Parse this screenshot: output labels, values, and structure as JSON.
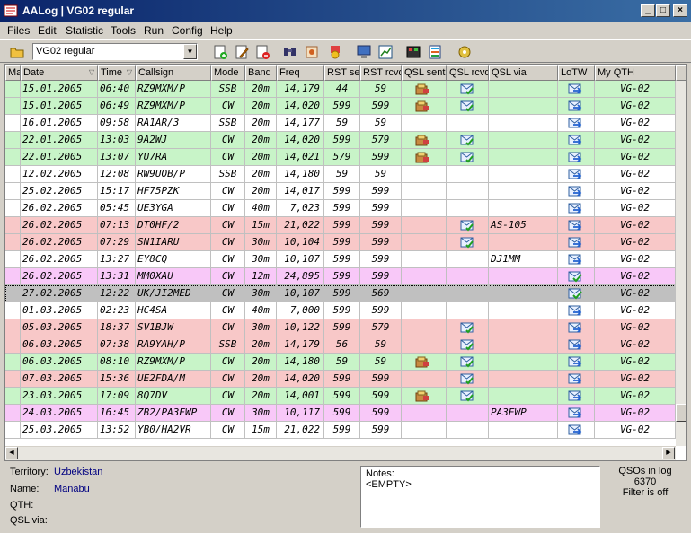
{
  "window": {
    "title": "AALog | VG02 regular"
  },
  "menu": [
    "Files",
    "Edit",
    "Statistic",
    "Tools",
    "Run",
    "Config",
    "Help"
  ],
  "toolbar": {
    "log_selector": "VG02 regular"
  },
  "columns": [
    "Ma",
    "Date",
    "Time",
    "Callsign",
    "Mode",
    "Band",
    "Freq",
    "RST sen",
    "RST rcvd",
    "QSL sent",
    "QSL rcvd",
    "QSL via",
    "LoTW",
    "My QTH"
  ],
  "rows": [
    {
      "c": "green",
      "date": "15.01.2005",
      "time": "06:40",
      "call": "RZ9MXM/P",
      "mode": "SSB",
      "band": "20m",
      "freq": "14,179",
      "rsts": "44",
      "rstr": "59",
      "qs": true,
      "qr": true,
      "via": "",
      "lotw": "send",
      "qth": "VG-02"
    },
    {
      "c": "green",
      "date": "15.01.2005",
      "time": "06:49",
      "call": "RZ9MXM/P",
      "mode": "CW",
      "band": "20m",
      "freq": "14,020",
      "rsts": "599",
      "rstr": "599",
      "qs": true,
      "qr": true,
      "via": "",
      "lotw": "send",
      "qth": "VG-02"
    },
    {
      "c": "white",
      "date": "16.01.2005",
      "time": "09:58",
      "call": "RA1AR/3",
      "mode": "SSB",
      "band": "20m",
      "freq": "14,177",
      "rsts": "59",
      "rstr": "59",
      "qs": false,
      "qr": false,
      "via": "",
      "lotw": "send",
      "qth": "VG-02"
    },
    {
      "c": "green",
      "date": "22.01.2005",
      "time": "13:03",
      "call": "9A2WJ",
      "mode": "CW",
      "band": "20m",
      "freq": "14,020",
      "rsts": "599",
      "rstr": "579",
      "qs": true,
      "qr": true,
      "via": "",
      "lotw": "send",
      "qth": "VG-02"
    },
    {
      "c": "green",
      "date": "22.01.2005",
      "time": "13:07",
      "call": "YU7RA",
      "mode": "CW",
      "band": "20m",
      "freq": "14,021",
      "rsts": "579",
      "rstr": "599",
      "qs": true,
      "qr": true,
      "via": "",
      "lotw": "send",
      "qth": "VG-02"
    },
    {
      "c": "white",
      "date": "12.02.2005",
      "time": "12:08",
      "call": "RW9UOB/P",
      "mode": "SSB",
      "band": "20m",
      "freq": "14,180",
      "rsts": "59",
      "rstr": "59",
      "qs": false,
      "qr": false,
      "via": "",
      "lotw": "send",
      "qth": "VG-02"
    },
    {
      "c": "white",
      "date": "25.02.2005",
      "time": "15:17",
      "call": "HF75PZK",
      "mode": "CW",
      "band": "20m",
      "freq": "14,017",
      "rsts": "599",
      "rstr": "599",
      "qs": false,
      "qr": false,
      "via": "",
      "lotw": "send",
      "qth": "VG-02"
    },
    {
      "c": "white",
      "date": "26.02.2005",
      "time": "05:45",
      "call": "UE3YGA",
      "mode": "CW",
      "band": "40m",
      "freq": "7,023",
      "rsts": "599",
      "rstr": "599",
      "qs": false,
      "qr": false,
      "via": "",
      "lotw": "send",
      "qth": "VG-02"
    },
    {
      "c": "red",
      "date": "26.02.2005",
      "time": "07:13",
      "call": "DT0HF/2",
      "mode": "CW",
      "band": "15m",
      "freq": "21,022",
      "rsts": "599",
      "rstr": "599",
      "qs": false,
      "qr": true,
      "via": "AS-105",
      "lotw": "send",
      "qth": "VG-02"
    },
    {
      "c": "red",
      "date": "26.02.2005",
      "time": "07:29",
      "call": "SN1IARU",
      "mode": "CW",
      "band": "30m",
      "freq": "10,104",
      "rsts": "599",
      "rstr": "599",
      "qs": false,
      "qr": true,
      "via": "",
      "lotw": "send",
      "qth": "VG-02"
    },
    {
      "c": "white",
      "date": "26.02.2005",
      "time": "13:27",
      "call": "EY8CQ",
      "mode": "CW",
      "band": "30m",
      "freq": "10,107",
      "rsts": "599",
      "rstr": "599",
      "qs": false,
      "qr": false,
      "via": "DJ1MM",
      "lotw": "send",
      "qth": "VG-02"
    },
    {
      "c": "pink",
      "date": "26.02.2005",
      "time": "13:31",
      "call": "MM0XAU",
      "mode": "CW",
      "band": "12m",
      "freq": "24,895",
      "rsts": "599",
      "rstr": "599",
      "qs": false,
      "qr": false,
      "via": "",
      "lotw": "conf",
      "qth": "VG-02"
    },
    {
      "c": "sel",
      "date": "27.02.2005",
      "time": "12:22",
      "call": "UK/JI2MED",
      "mode": "CW",
      "band": "30m",
      "freq": "10,107",
      "rsts": "599",
      "rstr": "569",
      "qs": false,
      "qr": false,
      "via": "",
      "lotw": "conf",
      "qth": "VG-02"
    },
    {
      "c": "white",
      "date": "01.03.2005",
      "time": "02:23",
      "call": "HC4SA",
      "mode": "CW",
      "band": "40m",
      "freq": "7,000",
      "rsts": "599",
      "rstr": "599",
      "qs": false,
      "qr": false,
      "via": "",
      "lotw": "send",
      "qth": "VG-02"
    },
    {
      "c": "red",
      "date": "05.03.2005",
      "time": "18:37",
      "call": "SV1BJW",
      "mode": "CW",
      "band": "30m",
      "freq": "10,122",
      "rsts": "599",
      "rstr": "579",
      "qs": false,
      "qr": true,
      "via": "",
      "lotw": "send",
      "qth": "VG-02"
    },
    {
      "c": "red",
      "date": "06.03.2005",
      "time": "07:38",
      "call": "RA9YAH/P",
      "mode": "SSB",
      "band": "20m",
      "freq": "14,179",
      "rsts": "56",
      "rstr": "59",
      "qs": false,
      "qr": true,
      "via": "",
      "lotw": "send",
      "qth": "VG-02"
    },
    {
      "c": "green",
      "date": "06.03.2005",
      "time": "08:10",
      "call": "RZ9MXM/P",
      "mode": "CW",
      "band": "20m",
      "freq": "14,180",
      "rsts": "59",
      "rstr": "59",
      "qs": true,
      "qr": true,
      "via": "",
      "lotw": "send",
      "qth": "VG-02"
    },
    {
      "c": "red",
      "date": "07.03.2005",
      "time": "15:36",
      "call": "UE2FDA/M",
      "mode": "CW",
      "band": "20m",
      "freq": "14,020",
      "rsts": "599",
      "rstr": "599",
      "qs": false,
      "qr": true,
      "via": "",
      "lotw": "send",
      "qth": "VG-02"
    },
    {
      "c": "green",
      "date": "23.03.2005",
      "time": "17:09",
      "call": "8Q7DV",
      "mode": "CW",
      "band": "20m",
      "freq": "14,001",
      "rsts": "599",
      "rstr": "599",
      "qs": true,
      "qr": true,
      "via": "",
      "lotw": "send",
      "qth": "VG-02"
    },
    {
      "c": "pink",
      "date": "24.03.2005",
      "time": "16:45",
      "call": "ZB2/PA3EWP",
      "mode": "CW",
      "band": "30m",
      "freq": "10,117",
      "rsts": "599",
      "rstr": "599",
      "qs": false,
      "qr": false,
      "via": "PA3EWP",
      "lotw": "send",
      "qth": "VG-02"
    },
    {
      "c": "white",
      "date": "25.03.2005",
      "time": "13:52",
      "call": "YB0/HA2VR",
      "mode": "CW",
      "band": "15m",
      "freq": "21,022",
      "rsts": "599",
      "rstr": "599",
      "qs": false,
      "qr": false,
      "via": "",
      "lotw": "send",
      "qth": "VG-02"
    }
  ],
  "info": {
    "territory_label": "Territory:",
    "territory": "Uzbekistan",
    "name_label": "Name:",
    "name": "Manabu",
    "qth_label": "QTH:",
    "qth": "",
    "qslvia_label": "QSL via:",
    "qslvia": ""
  },
  "notes": {
    "label": "Notes:",
    "value": "<EMPTY>"
  },
  "stats": {
    "line1": "QSOs in log",
    "count": "6370",
    "filter": "Filter is off"
  },
  "colors": {
    "green": "#c8f4c8",
    "red": "#f8c8c8",
    "pink": "#f8c8f8",
    "selected": "#c0c0c0"
  }
}
